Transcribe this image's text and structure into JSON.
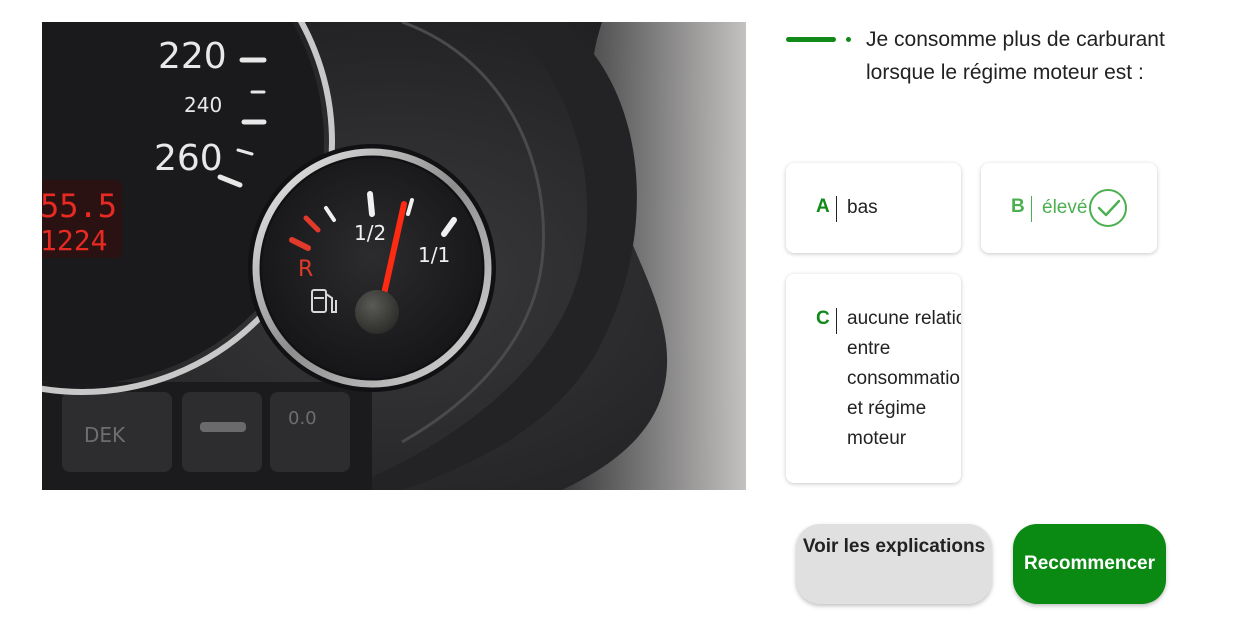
{
  "image": {
    "alt_icon": "fuel-gauge-photo",
    "dial_labels": {
      "s220": "220",
      "s240": "240",
      "s260": "260",
      "odo_top": "55.5",
      "odo_bottom": "1224",
      "reserve": "R",
      "half": "1/2",
      "full": "1/1",
      "button_label": "DEK",
      "button_label2": "0.0"
    }
  },
  "question": {
    "text": "Je consomme plus de carburant lorsque le régime moteur est :"
  },
  "answers": [
    {
      "letter": "A",
      "text": "bas"
    },
    {
      "letter": "B",
      "text": "élevé",
      "state_icon": "check-circle-icon"
    },
    {
      "letter": "C",
      "text": "aucune relation entre consommation et régime moteur"
    }
  ],
  "buttons": {
    "explain": "Voir les explications",
    "restart": "Recommencer"
  },
  "colors": {
    "accent": "#118a1a",
    "correct": "#4caf50",
    "button_primary": "#0a8a12",
    "button_secondary": "#e0e0e0"
  }
}
